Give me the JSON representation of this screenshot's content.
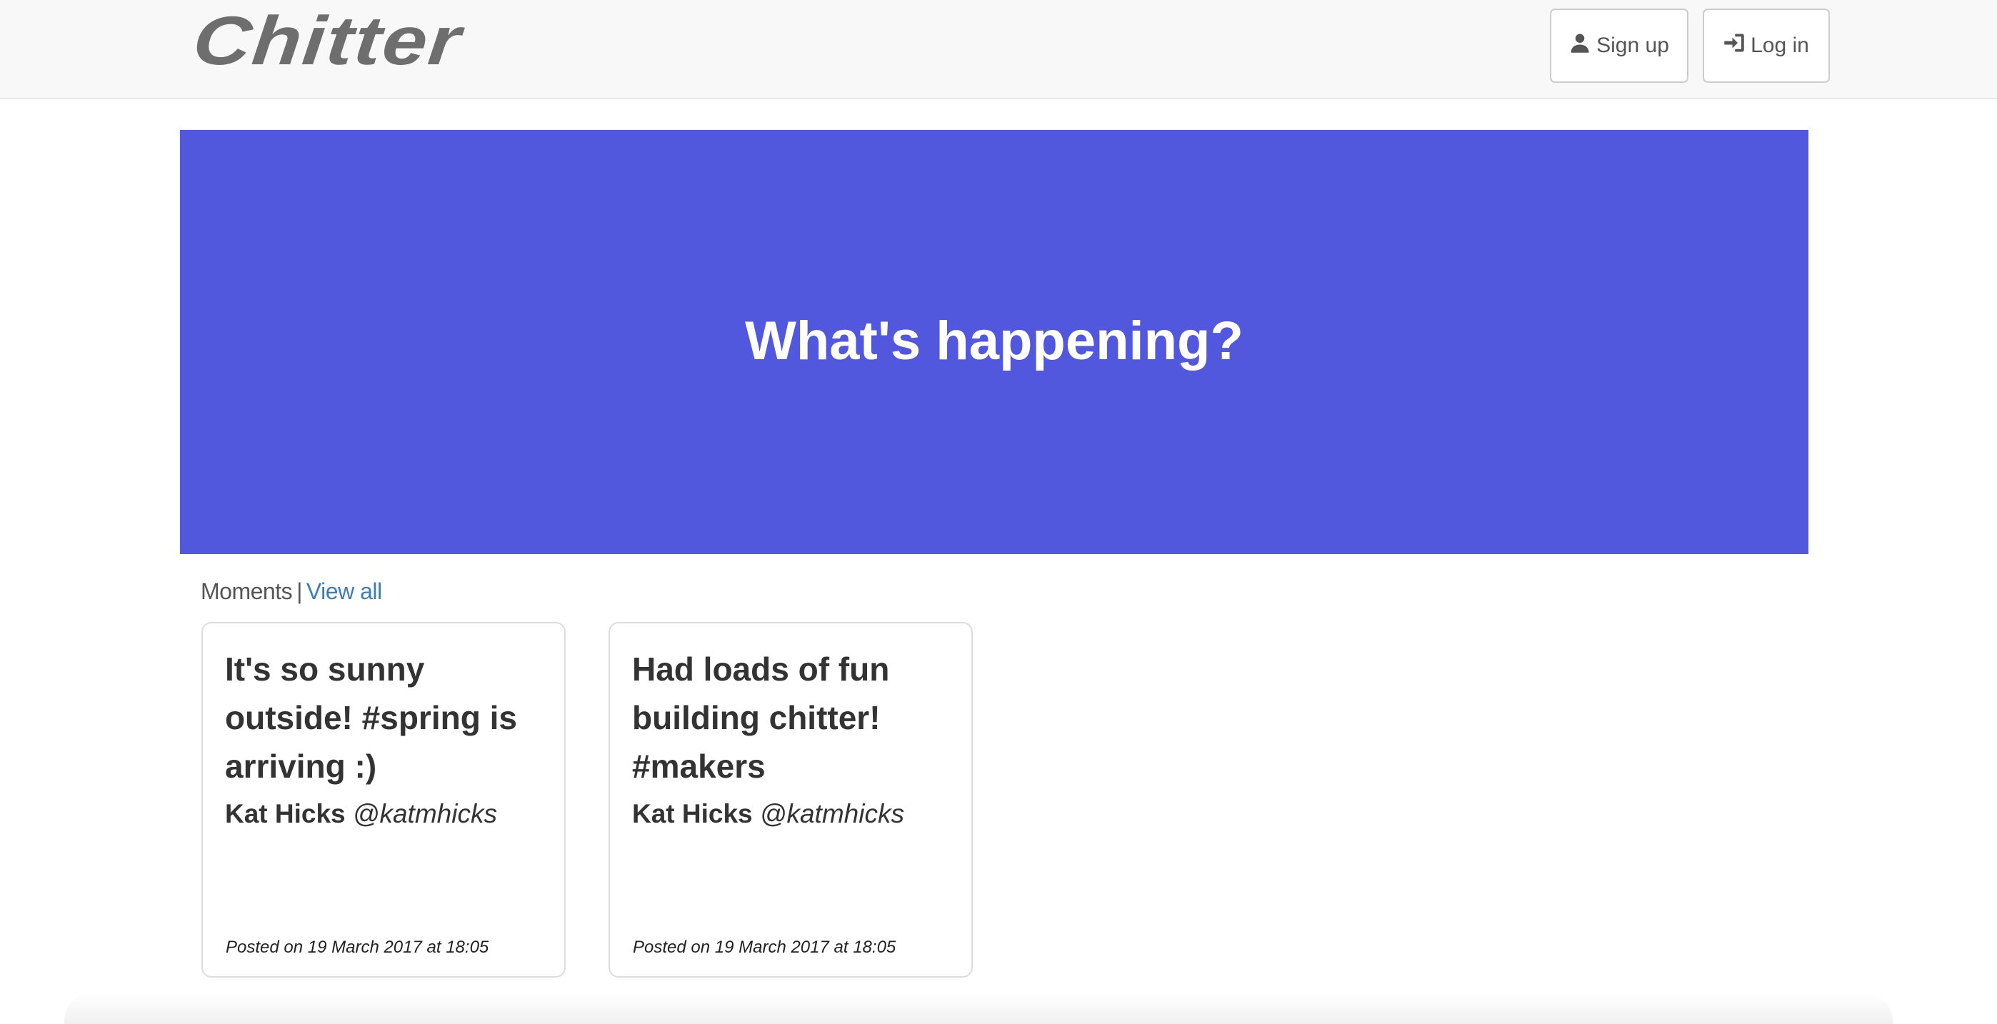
{
  "header": {
    "brand": "Chitter",
    "signup_label": "Sign up",
    "login_label": "Log in"
  },
  "hero": {
    "title": "What's happening?",
    "background_color": "#5158de"
  },
  "moments": {
    "label": "Moments",
    "separator": "|",
    "view_all_label": "View all"
  },
  "peeps": [
    {
      "text": "It's so sunny outside! #spring is arriving :)",
      "author_name": "Kat Hicks",
      "author_handle": "@katmhicks",
      "posted": "Posted on 19 March 2017 at 18:05"
    },
    {
      "text": "Had loads of fun building chitter! #makers",
      "author_name": "Kat Hicks",
      "author_handle": "@katmhicks",
      "posted": "Posted on 19 March 2017 at 18:05"
    }
  ],
  "icons": {
    "signup": "user-icon",
    "login": "log-in-icon"
  }
}
